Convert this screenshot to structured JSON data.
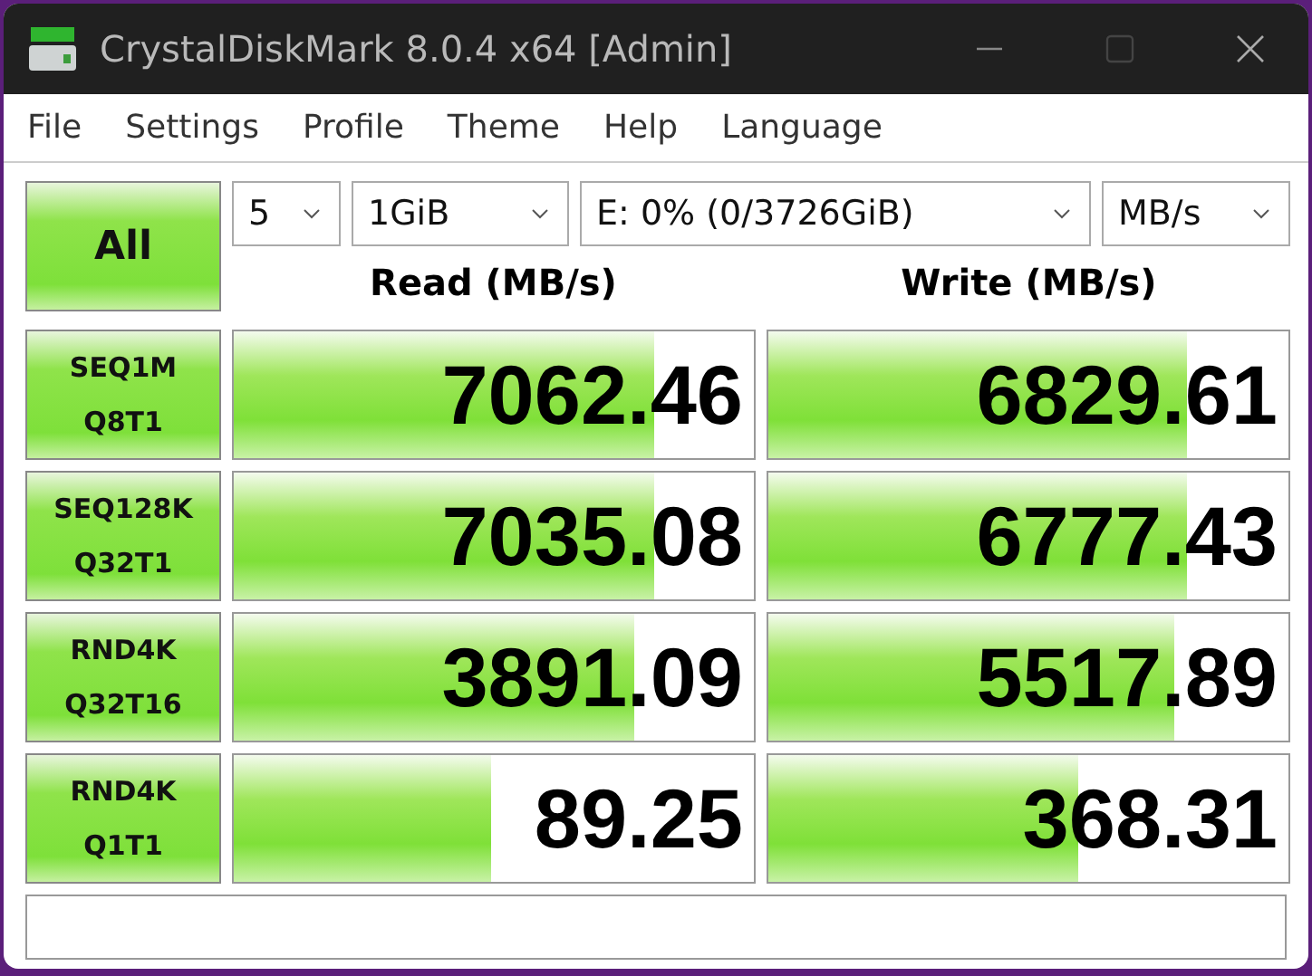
{
  "window": {
    "title": "CrystalDiskMark 8.0.4 x64 [Admin]"
  },
  "menu": [
    "File",
    "Settings",
    "Profile",
    "Theme",
    "Help",
    "Language"
  ],
  "all_button": "All",
  "selectors": {
    "count": "5",
    "size": "1GiB",
    "drive": "E: 0% (0/3726GiB)",
    "unit": "MB/s"
  },
  "columns": [
    "Read (MB/s)",
    "Write (MB/s)"
  ],
  "rows": [
    {
      "test": [
        "SEQ1M",
        "Q8T1"
      ],
      "read": {
        "value": "7062.46",
        "level": 0.81
      },
      "write": {
        "value": "6829.61",
        "level": 0.805
      }
    },
    {
      "test": [
        "SEQ128K",
        "Q32T1"
      ],
      "read": {
        "value": "7035.08",
        "level": 0.81
      },
      "write": {
        "value": "6777.43",
        "level": 0.805
      }
    },
    {
      "test": [
        "RND4K",
        "Q32T16"
      ],
      "read": {
        "value": "3891.09",
        "level": 0.77
      },
      "write": {
        "value": "5517.89",
        "level": 0.78
      }
    },
    {
      "test": [
        "RND4K",
        "Q1T1"
      ],
      "read": {
        "value": "89.25",
        "level": 0.495
      },
      "write": {
        "value": "368.31",
        "level": 0.595
      }
    }
  ]
}
